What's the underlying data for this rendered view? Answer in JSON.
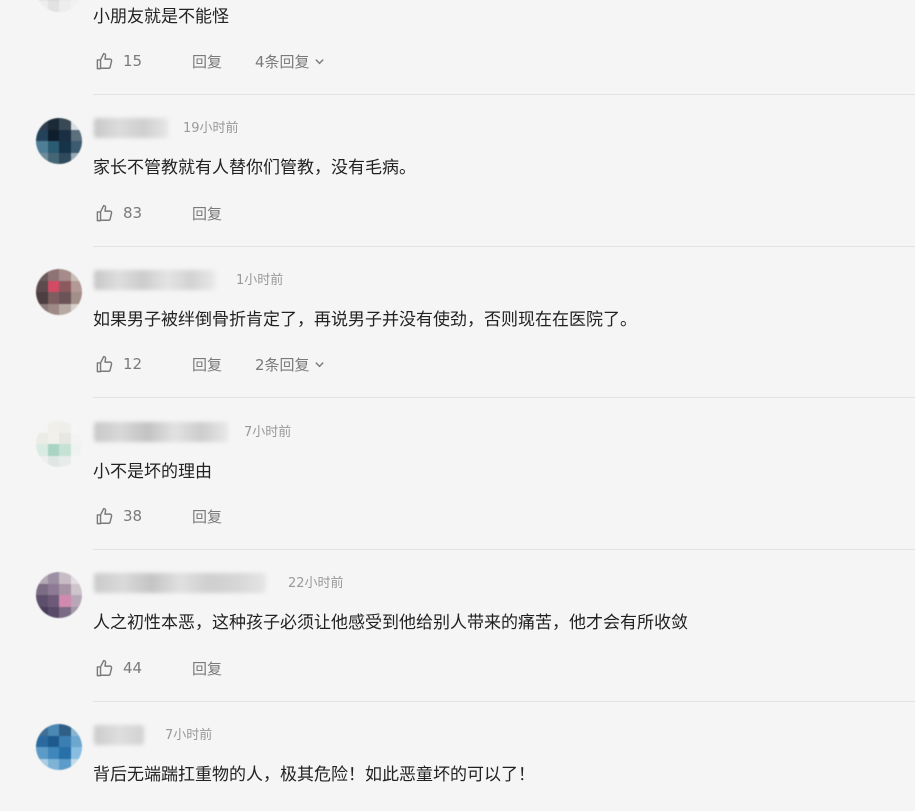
{
  "comments": [
    {
      "content": "小朋友就是不能怪",
      "likes": "15",
      "reply_label": "回复",
      "more_replies": "4条回复"
    },
    {
      "time": "19小时前",
      "content": "家长不管教就有人替你们管教，没有毛病。",
      "likes": "83",
      "reply_label": "回复"
    },
    {
      "time": "1小时前",
      "content": "如果男子被绊倒骨折肯定了，再说男子并没有使劲，否则现在在医院了。",
      "likes": "12",
      "reply_label": "回复",
      "more_replies": "2条回复"
    },
    {
      "time": "7小时前",
      "content": "小不是坏的理由",
      "likes": "38",
      "reply_label": "回复"
    },
    {
      "time": "22小时前",
      "content": "人之初性本恶，这种孩子必须让他感受到他给别人带来的痛苦，他才会有所收敛",
      "likes": "44",
      "reply_label": "回复"
    },
    {
      "time": "7小时前",
      "content": "背后无端踹扛重物的人，极其危险！如此恶童坏的可以了！"
    }
  ],
  "icons": {
    "like": "thumbs-up-icon",
    "expand": "chevron-down-icon"
  },
  "colors": {
    "background": "#f5f5f5",
    "text": "#222222",
    "meta": "#999999",
    "action": "#7a7a7a",
    "divider": "#e3e3e3"
  }
}
